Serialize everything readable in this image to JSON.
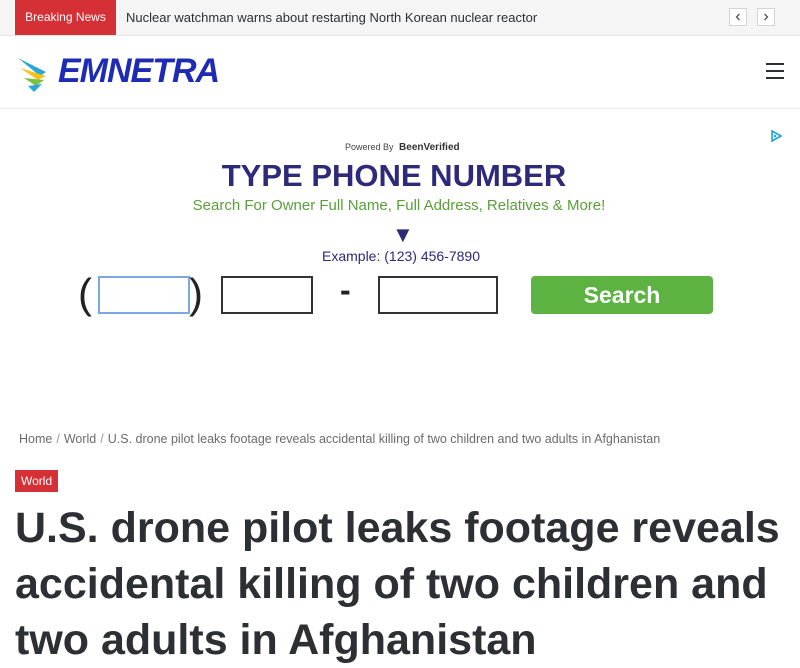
{
  "topbar": {
    "breaking_label": "Breaking News",
    "headline": "Nuclear watchman warns about restarting North Korean nuclear reactor",
    "prev_icon": "chevron-left-icon",
    "next_icon": "chevron-right-icon"
  },
  "header": {
    "logo_text": "EMNETRA",
    "menu_icon": "hamburger-menu-icon"
  },
  "ad": {
    "powered_by": "Powered By",
    "powered_brand": "BeenVerified",
    "title": "TYPE PHONE NUMBER",
    "subtitle": "Search For Owner Full Name, Full Address, Relatives & More!",
    "arrow": "▼",
    "example": "Example: (123) 456-7890",
    "paren_open": "(",
    "paren_close": ")",
    "dash": "-",
    "search_label": "Search",
    "area_code": "",
    "prefix": "",
    "line_number": ""
  },
  "breadcrumb": {
    "home": "Home",
    "section": "World",
    "current": "U.S. drone pilot leaks footage reveals accidental killing of two children and two adults in Afghanistan",
    "separator": "/"
  },
  "article": {
    "category": "World",
    "title": "U.S. drone pilot leaks footage reveals accidental killing of two children and two adults in Afghanistan"
  },
  "colors": {
    "accent": "#d53035",
    "ad_navy": "#2d2a7a",
    "ad_green": "#5cb341",
    "logo_blue": "#1e2bb4"
  }
}
